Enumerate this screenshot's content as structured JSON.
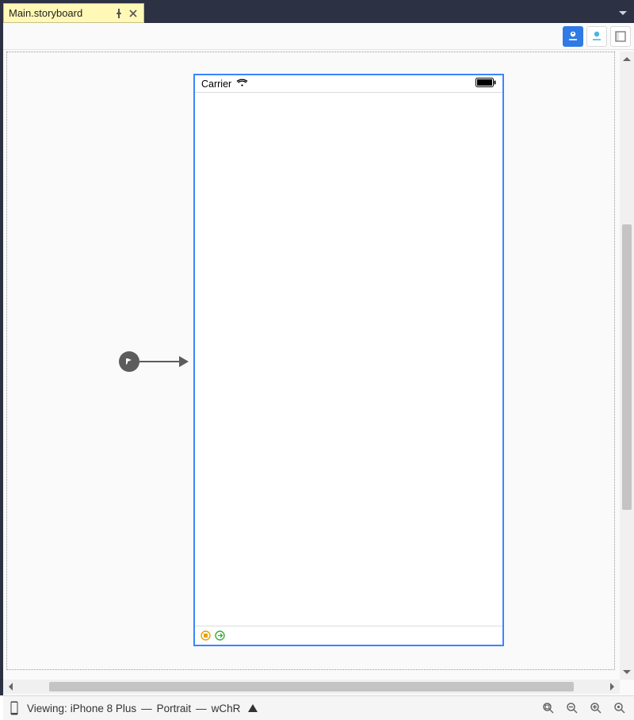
{
  "tab": {
    "title": "Main.storyboard"
  },
  "canvas": {
    "carrier": "Carrier"
  },
  "footer": {
    "prefix": "Viewing:",
    "device": "iPhone 8 Plus",
    "orientation": "Portrait",
    "size_class": "wChR"
  }
}
